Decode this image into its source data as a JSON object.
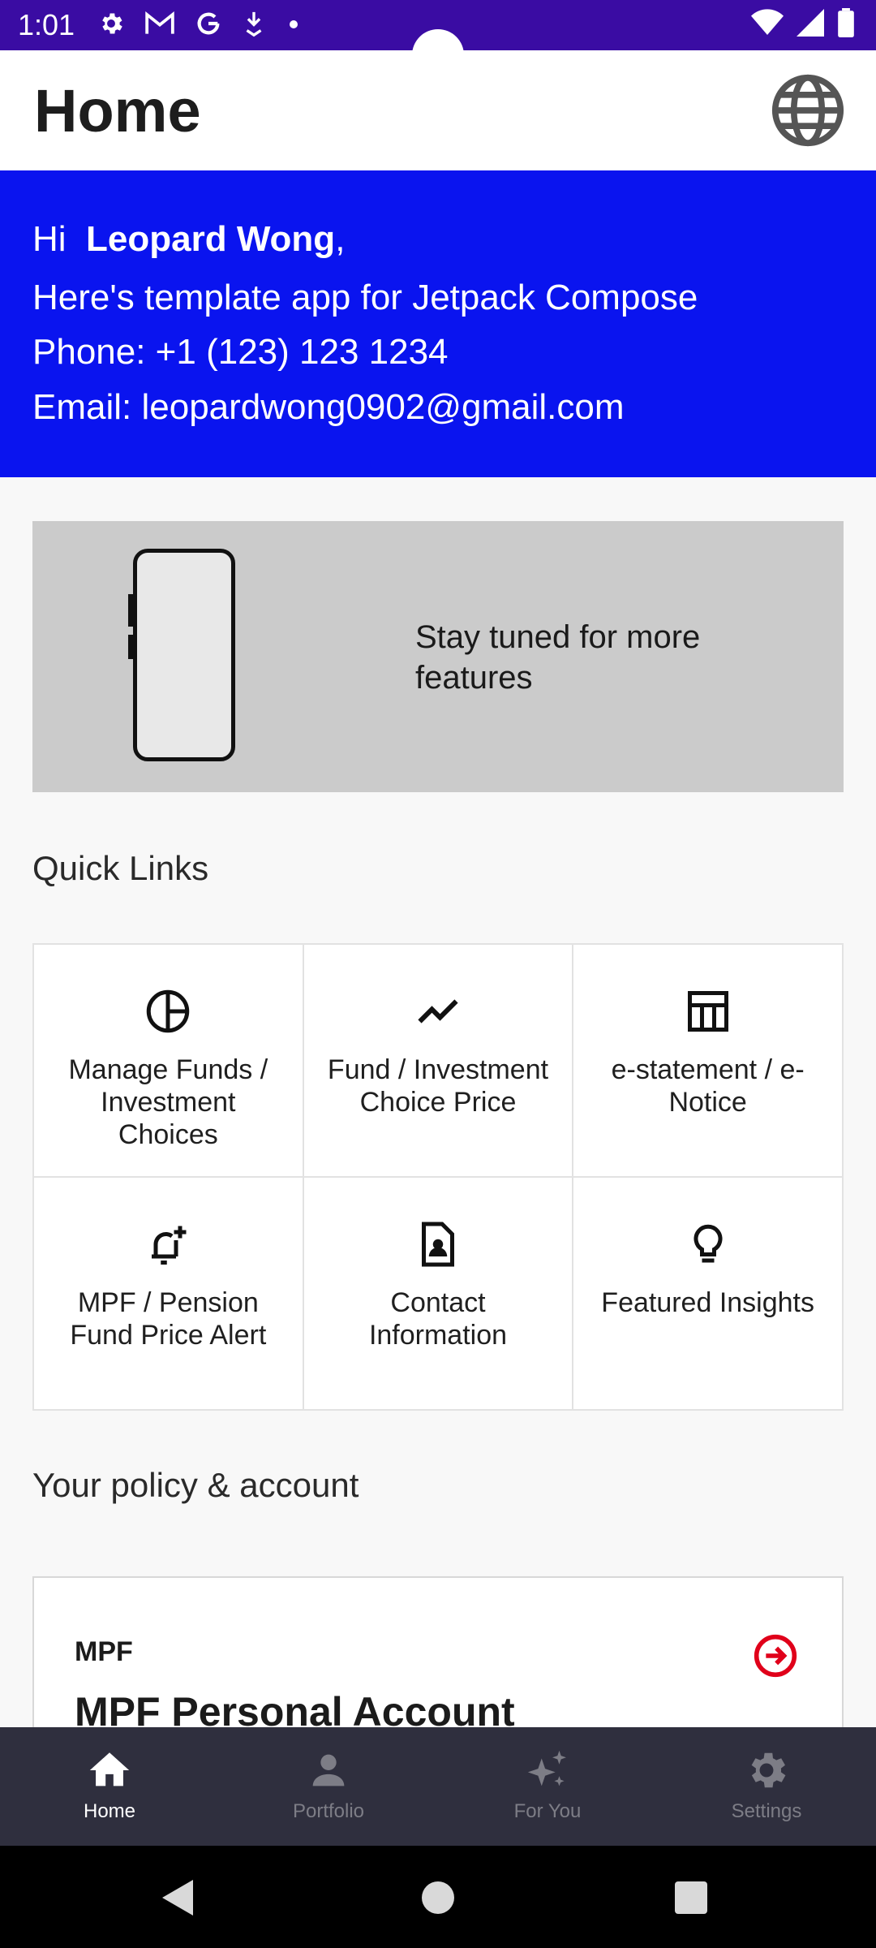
{
  "status_bar": {
    "time": "1:01",
    "icons": [
      "gear-icon",
      "gmail-icon",
      "google-icon",
      "download-icon",
      "dot-icon",
      "wifi-icon",
      "signal-icon",
      "battery-icon"
    ]
  },
  "app_bar": {
    "title": "Home",
    "action_icon": "globe-icon"
  },
  "greeting": {
    "hi": "Hi",
    "name": "Leopard Wong",
    "comma": ",",
    "subtitle": "Here's template app for Jetpack Compose",
    "phone": "Phone: +1 (123) 123 1234",
    "email": "Email: leopardwong0902@gmail.com"
  },
  "banner": {
    "text": "Stay tuned for more features",
    "image_icon": "smartphone-icon"
  },
  "quick_links": {
    "title": "Quick Links",
    "items": [
      {
        "label": "Manage Funds / Investment Choices",
        "icon": "pie-chart-icon"
      },
      {
        "label": "Fund / Investment Choice Price",
        "icon": "trending-up-icon"
      },
      {
        "label": "e-statement / e-Notice",
        "icon": "table-icon"
      },
      {
        "label": "MPF / Pension Fund Price Alert",
        "icon": "bell-plus-icon"
      },
      {
        "label": "Contact Information",
        "icon": "contact-file-icon"
      },
      {
        "label": "Featured Insights",
        "icon": "lightbulb-icon"
      }
    ]
  },
  "policy": {
    "title": "Your policy & account",
    "card": {
      "tag": "MPF",
      "name": "MPF Personal Account",
      "icon": "arrow-circle-right-icon",
      "accent": "#e0001a"
    }
  },
  "bottom_nav": {
    "items": [
      {
        "label": "Home",
        "icon": "home-icon",
        "active": true
      },
      {
        "label": "Portfolio",
        "icon": "person-icon",
        "active": false
      },
      {
        "label": "For You",
        "icon": "sparkle-icon",
        "active": false
      },
      {
        "label": "Settings",
        "icon": "settings-icon",
        "active": false
      }
    ]
  },
  "colors": {
    "status_bar": "#3a0ca3",
    "hero": "#0a14ef",
    "banner": "#cbcbcb",
    "bottom_nav": "#2f2f3e"
  }
}
